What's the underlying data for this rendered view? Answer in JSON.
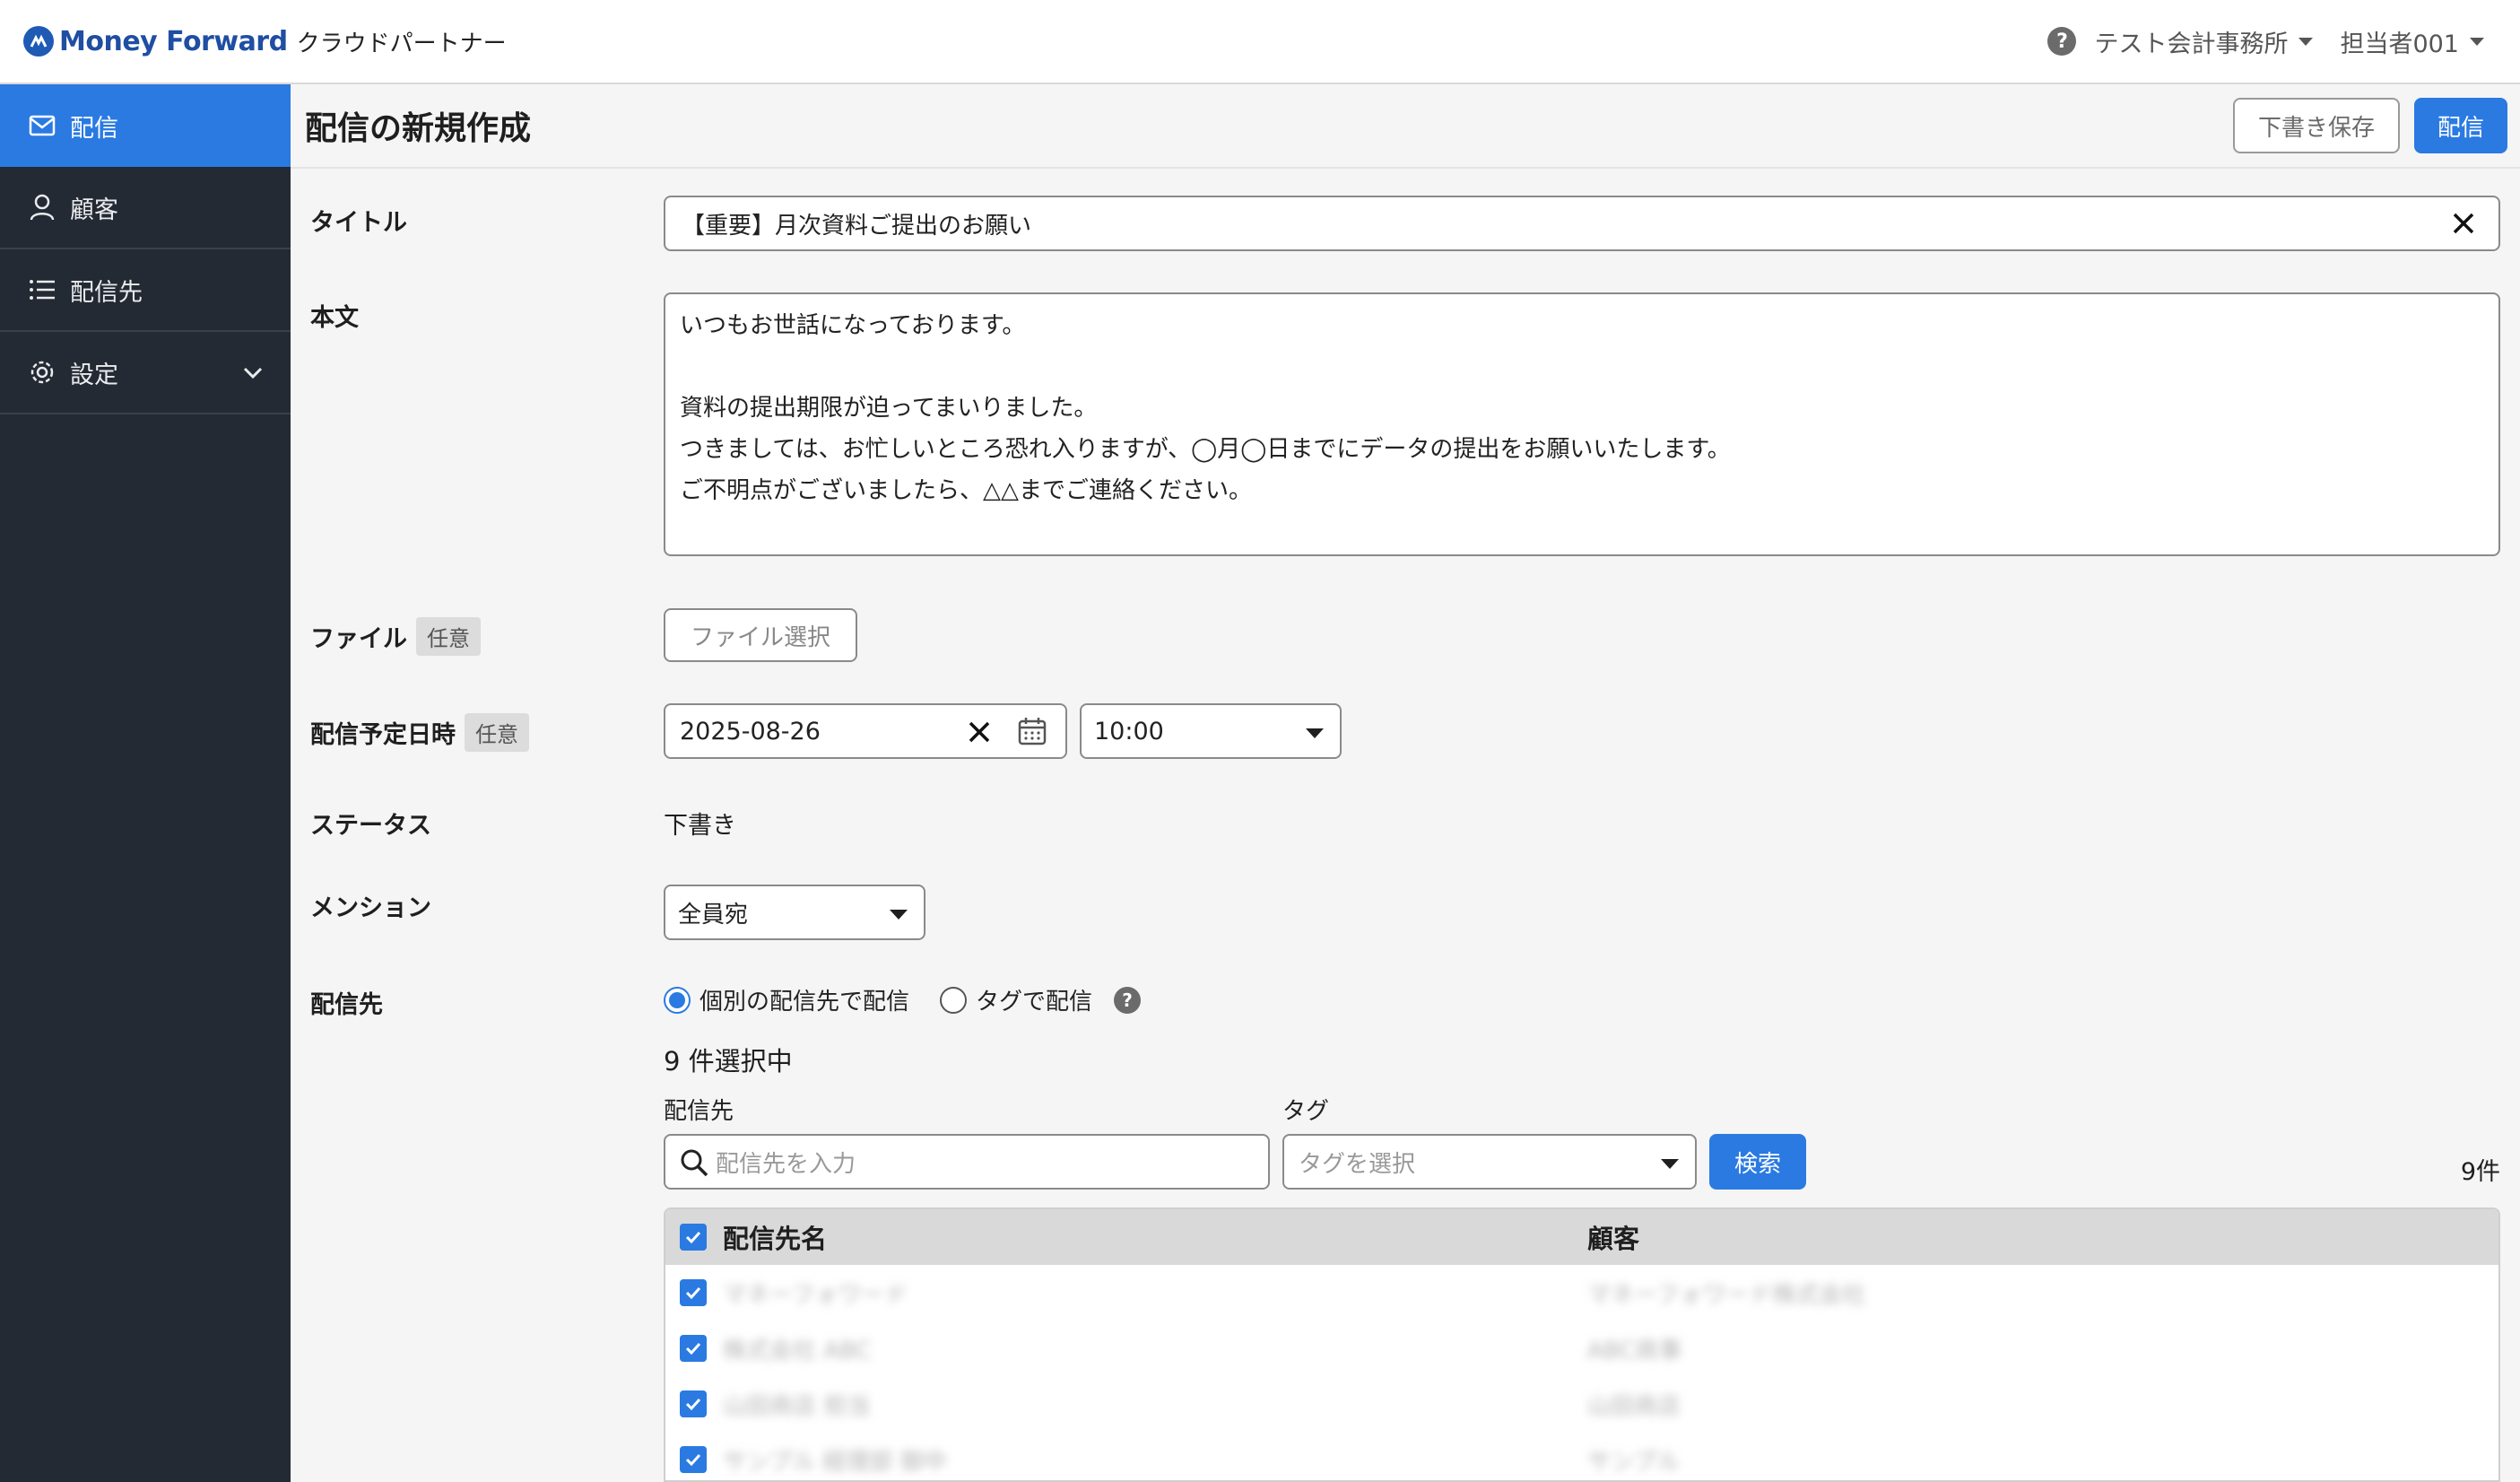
{
  "header": {
    "logo_main": "Money Forward",
    "logo_sub": "クラウドパートナー",
    "help_icon": "question-circle-icon",
    "office_name": "テスト会計事務所",
    "user_name": "担当者001"
  },
  "sidebar": {
    "items": [
      {
        "label": "配信",
        "icon": "mail-icon",
        "active": true
      },
      {
        "label": "顧客",
        "icon": "person-icon",
        "active": false
      },
      {
        "label": "配信先",
        "icon": "list-icon",
        "active": false
      },
      {
        "label": "設定",
        "icon": "gear-icon",
        "active": false,
        "expandable": true
      }
    ]
  },
  "page": {
    "title": "配信の新規作成",
    "save_draft_label": "下書き保存",
    "send_label": "配信"
  },
  "form": {
    "title_label": "タイトル",
    "title_value": "【重要】月次資料ご提出のお願い",
    "body_label": "本文",
    "body_lines": [
      "いつもお世話になっております。",
      "",
      "資料の提出期限が迫ってまいりました。",
      "つきましては、お忙しいところ恐れ入りますが、◯月◯日までにデータの提出をお願いいたします。",
      "ご不明点がございましたら、△△までご連絡ください。"
    ],
    "file_label": "ファイル",
    "optional_badge": "任意",
    "file_button": "ファイル選択",
    "schedule_label": "配信予定日時",
    "date_value": "2025-08-26",
    "time_value": "10:00",
    "status_label": "ステータス",
    "status_value": "下書き",
    "mention_label": "メンション",
    "mention_value": "全員宛",
    "recipients_label": "配信先",
    "radio_individual": "個別の配信先で配信",
    "radio_tag": "タグで配信",
    "selected_count": "9 件選択中",
    "filter_recipient_label": "配信先",
    "filter_recipient_placeholder": "配信先を入力",
    "filter_tag_label": "タグ",
    "filter_tag_placeholder": "タグを選択",
    "search_button": "検索",
    "result_count": "9件"
  },
  "table": {
    "col_name": "配信先名",
    "col_customer": "顧客",
    "rows": [
      {
        "name": "マネーフォワード",
        "customer": "マネーフォワード株式会社",
        "checked": true
      },
      {
        "name": "株式会社 ABC",
        "customer": "ABC商事",
        "checked": true
      },
      {
        "name": "山田商店 担当",
        "customer": "山田商店",
        "checked": true
      },
      {
        "name": "サンプル 経理部 御中",
        "customer": "サンプル",
        "checked": true
      }
    ]
  },
  "colors": {
    "accent": "#2a7ae2",
    "sidebar_bg": "#242a33",
    "brand": "#1f4ea3"
  }
}
